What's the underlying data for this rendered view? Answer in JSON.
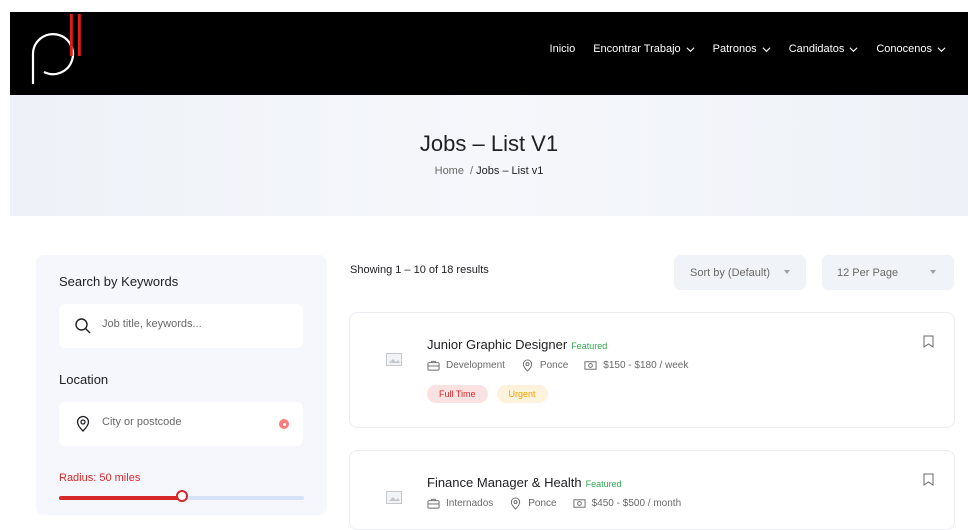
{
  "nav": {
    "items": [
      {
        "label": "Inicio",
        "has_dropdown": false
      },
      {
        "label": "Encontrar Trabajo",
        "has_dropdown": true
      },
      {
        "label": "Patronos",
        "has_dropdown": true
      },
      {
        "label": "Candidatos",
        "has_dropdown": true
      },
      {
        "label": "Conocenos",
        "has_dropdown": true
      }
    ]
  },
  "hero": {
    "title": "Jobs – List V1",
    "breadcrumb_home": "Home",
    "breadcrumb_sep": "/",
    "breadcrumb_current": "Jobs – List v1"
  },
  "sidebar": {
    "keywords_title": "Search by Keywords",
    "keywords_placeholder": "Job title, keywords...",
    "location_title": "Location",
    "location_placeholder": "City or postcode",
    "radius_label": "Radius: 50 miles",
    "radius_value_fraction": 0.5
  },
  "toolbar": {
    "results_text": "Showing 1 – 10 of 18 results",
    "sort_label": "Sort by (Default)",
    "per_page_label": "12 Per Page"
  },
  "jobs": [
    {
      "title": "Junior Graphic Designer",
      "featured": "Featured",
      "category": "Development",
      "location": "Ponce",
      "salary": "$150 - $180 / week",
      "tags": [
        "Full Time",
        "Urgent"
      ]
    },
    {
      "title": "Finance Manager & Health",
      "featured": "Featured",
      "category": "Internados",
      "location": "Ponce",
      "salary": "$450 - $500 / month",
      "tags": []
    }
  ],
  "colors": {
    "accent": "#d62828",
    "header_bg": "#000000",
    "featured": "#34a853",
    "urgent": "#f0a300"
  }
}
